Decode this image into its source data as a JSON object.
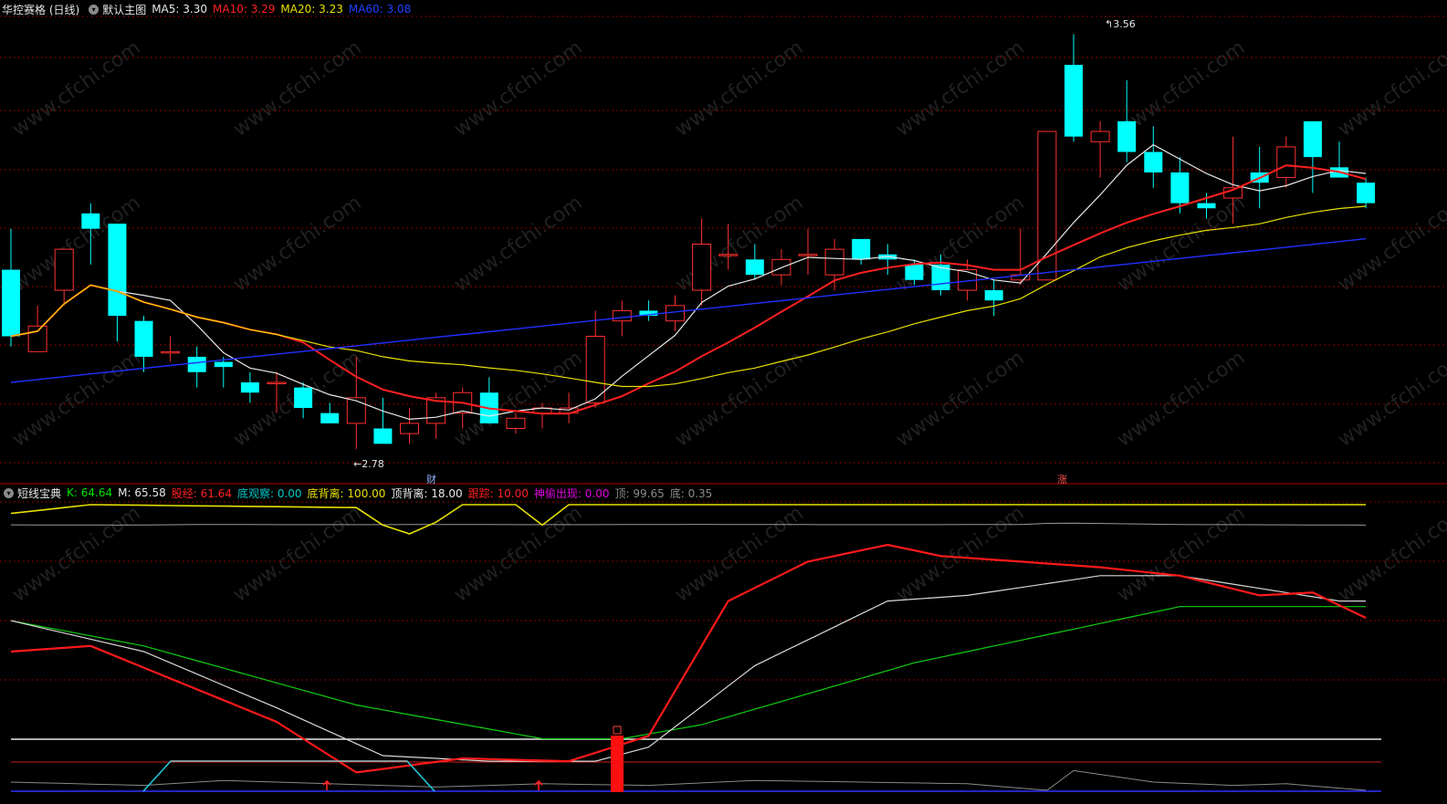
{
  "main": {
    "stock_name": "华控赛格 (日线)",
    "template_label": "默认主图",
    "ma5": {
      "label": "MA5:",
      "value": "3.30",
      "color": "#e8e8e8"
    },
    "ma10": {
      "label": "MA10:",
      "value": "3.29",
      "color": "#ff2020"
    },
    "ma20": {
      "label": "MA20:",
      "value": "3.23",
      "color": "#e8e000"
    },
    "ma60": {
      "label": "MA60:",
      "value": "3.08",
      "color": "#2020ff"
    },
    "high_marker": "3.56",
    "low_marker": "2.78",
    "event_cai": "财",
    "event_zhang": "涨"
  },
  "indicator": {
    "name": "短线宝典",
    "k": {
      "label": "K:",
      "value": "64.64",
      "color": "#00e000"
    },
    "m": {
      "label": "M:",
      "value": "65.58",
      "color": "#e8e8e8"
    },
    "gujing": {
      "label": "股经:",
      "value": "61.64",
      "color": "#ff2020"
    },
    "diguancha": {
      "label": "底观察:",
      "value": "0.00",
      "color": "#00c8c8"
    },
    "dibeili": {
      "label": "底背离:",
      "value": "100.00",
      "color": "#e8e000"
    },
    "dingbeili": {
      "label": "顶背离:",
      "value": "18.00",
      "color": "#e8e8e8"
    },
    "genzong": {
      "label": "跟踪:",
      "value": "10.00",
      "color": "#ff2020"
    },
    "shentou": {
      "label": "神偷出现:",
      "value": "0.00",
      "color": "#e000e0"
    },
    "ding": {
      "label": "顶:",
      "value": "99.65",
      "color": "#8a8a8a"
    },
    "di": {
      "label": "底:",
      "value": "0.35",
      "color": "#8a8a8a"
    }
  },
  "watermark": "www.cfchi.com",
  "colors": {
    "up": "#ff3030",
    "down": "#00ffff",
    "grid": "#8b0000"
  },
  "candles": [
    {
      "o": 3.1,
      "h": 3.18,
      "l": 2.95,
      "c": 2.97
    },
    {
      "o": 2.94,
      "h": 3.03,
      "l": 2.94,
      "c": 2.99
    },
    {
      "o": 3.06,
      "h": 3.14,
      "l": 3.03,
      "c": 3.14
    },
    {
      "o": 3.21,
      "h": 3.23,
      "l": 3.11,
      "c": 3.18
    },
    {
      "o": 3.19,
      "h": 3.19,
      "l": 2.96,
      "c": 3.01
    },
    {
      "o": 3.0,
      "h": 3.01,
      "l": 2.9,
      "c": 2.93
    },
    {
      "o": 2.94,
      "h": 2.97,
      "l": 2.92,
      "c": 2.94
    },
    {
      "o": 2.93,
      "h": 2.95,
      "l": 2.87,
      "c": 2.9
    },
    {
      "o": 2.92,
      "h": 2.93,
      "l": 2.87,
      "c": 2.91
    },
    {
      "o": 2.88,
      "h": 2.9,
      "l": 2.84,
      "c": 2.86
    },
    {
      "o": 2.88,
      "h": 2.9,
      "l": 2.82,
      "c": 2.88
    },
    {
      "o": 2.87,
      "h": 2.88,
      "l": 2.81,
      "c": 2.83
    },
    {
      "o": 2.82,
      "h": 2.84,
      "l": 2.8,
      "c": 2.8
    },
    {
      "o": 2.8,
      "h": 2.93,
      "l": 2.75,
      "c": 2.85
    },
    {
      "o": 2.79,
      "h": 2.85,
      "l": 2.77,
      "c": 2.76
    },
    {
      "o": 2.78,
      "h": 2.83,
      "l": 2.76,
      "c": 2.8
    },
    {
      "o": 2.8,
      "h": 2.86,
      "l": 2.77,
      "c": 2.85
    },
    {
      "o": 2.82,
      "h": 2.87,
      "l": 2.79,
      "c": 2.86
    },
    {
      "o": 2.86,
      "h": 2.89,
      "l": 2.82,
      "c": 2.8
    },
    {
      "o": 2.79,
      "h": 2.82,
      "l": 2.78,
      "c": 2.81
    },
    {
      "o": 2.82,
      "h": 2.84,
      "l": 2.79,
      "c": 2.83
    },
    {
      "o": 2.82,
      "h": 2.86,
      "l": 2.8,
      "c": 2.83
    },
    {
      "o": 2.84,
      "h": 3.02,
      "l": 2.83,
      "c": 2.97
    },
    {
      "o": 3.0,
      "h": 3.04,
      "l": 2.97,
      "c": 3.02
    },
    {
      "o": 3.02,
      "h": 3.04,
      "l": 3.0,
      "c": 3.01
    },
    {
      "o": 3.0,
      "h": 3.05,
      "l": 2.98,
      "c": 3.03
    },
    {
      "o": 3.06,
      "h": 3.2,
      "l": 3.03,
      "c": 3.15
    },
    {
      "o": 3.13,
      "h": 3.19,
      "l": 3.1,
      "c": 3.13
    },
    {
      "o": 3.12,
      "h": 3.15,
      "l": 3.08,
      "c": 3.09
    },
    {
      "o": 3.09,
      "h": 3.14,
      "l": 3.07,
      "c": 3.12
    },
    {
      "o": 3.13,
      "h": 3.18,
      "l": 3.09,
      "c": 3.13
    },
    {
      "o": 3.09,
      "h": 3.16,
      "l": 3.06,
      "c": 3.14
    },
    {
      "o": 3.16,
      "h": 3.16,
      "l": 3.11,
      "c": 3.12
    },
    {
      "o": 3.13,
      "h": 3.15,
      "l": 3.09,
      "c": 3.12
    },
    {
      "o": 3.11,
      "h": 3.12,
      "l": 3.07,
      "c": 3.08
    },
    {
      "o": 3.11,
      "h": 3.13,
      "l": 3.05,
      "c": 3.06
    },
    {
      "o": 3.06,
      "h": 3.12,
      "l": 3.04,
      "c": 3.1
    },
    {
      "o": 3.06,
      "h": 3.08,
      "l": 3.01,
      "c": 3.04
    },
    {
      "o": 3.08,
      "h": 3.18,
      "l": 3.07,
      "c": 3.09
    },
    {
      "o": 3.08,
      "h": 3.37,
      "l": 3.08,
      "c": 3.37
    },
    {
      "o": 3.5,
      "h": 3.56,
      "l": 3.35,
      "c": 3.36
    },
    {
      "o": 3.35,
      "h": 3.39,
      "l": 3.28,
      "c": 3.37
    },
    {
      "o": 3.39,
      "h": 3.47,
      "l": 3.31,
      "c": 3.33
    },
    {
      "o": 3.33,
      "h": 3.38,
      "l": 3.26,
      "c": 3.29
    },
    {
      "o": 3.29,
      "h": 3.32,
      "l": 3.21,
      "c": 3.23
    },
    {
      "o": 3.23,
      "h": 3.25,
      "l": 3.2,
      "c": 3.22
    },
    {
      "o": 3.24,
      "h": 3.36,
      "l": 3.19,
      "c": 3.26
    },
    {
      "o": 3.29,
      "h": 3.34,
      "l": 3.22,
      "c": 3.27
    },
    {
      "o": 3.28,
      "h": 3.36,
      "l": 3.26,
      "c": 3.34
    },
    {
      "o": 3.39,
      "h": 3.39,
      "l": 3.25,
      "c": 3.32
    },
    {
      "o": 3.3,
      "h": 3.35,
      "l": 3.28,
      "c": 3.28
    },
    {
      "o": 3.27,
      "h": 3.28,
      "l": 3.22,
      "c": 3.23
    }
  ]
}
